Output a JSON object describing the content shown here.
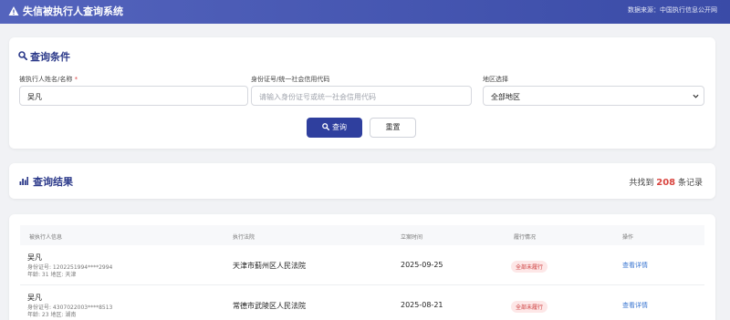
{
  "app": {
    "title": "失信被执行人查询系统",
    "data_source": "数据来源：中国执行信息公开网"
  },
  "query": {
    "section_title": "查询条件",
    "name_label": "被执行人姓名/名称",
    "name_required_mark": "*",
    "name_value": "吴凡",
    "id_label": "身份证号/统一社会信用代码",
    "id_placeholder": "请输入身份证号或统一社会信用代码",
    "region_label": "地区选择",
    "region_value": "全部地区",
    "search_button": "查询",
    "reset_button": "重置"
  },
  "results": {
    "section_title": "查询结果",
    "found_prefix": "共找到",
    "found_count": "208",
    "found_suffix": "条记录",
    "columns": [
      "被执行人信息",
      "执行法院",
      "立案时间",
      "履行情况",
      "操作"
    ],
    "rows": [
      {
        "name": "吴凡",
        "id_line": "身份证号: 1202251994****2994",
        "age_region": "年龄: 31 地区: 天津",
        "court": "天津市蓟州区人民法院",
        "date": "2025-09-25",
        "status": "全部未履行",
        "action": "查看详情"
      },
      {
        "name": "吴凡",
        "id_line": "身份证号: 4307022003****8513",
        "age_region": "年龄: 23 地区: 湖南",
        "court": "常德市武陵区人民法院",
        "date": "2025-08-21",
        "status": "全部未履行",
        "action": "查看详情"
      }
    ]
  },
  "icons": {
    "title_icon": "warning-triangle-icon",
    "query_icon": "search-icon",
    "results_icon": "bar-chart-icon"
  },
  "colors": {
    "header_start": "#5464bd",
    "header_end": "#3a4ba7",
    "primary": "#2f3f9e",
    "count_red": "#d9453f",
    "badge_bg": "#fde7e7",
    "link": "#3a76d1"
  }
}
